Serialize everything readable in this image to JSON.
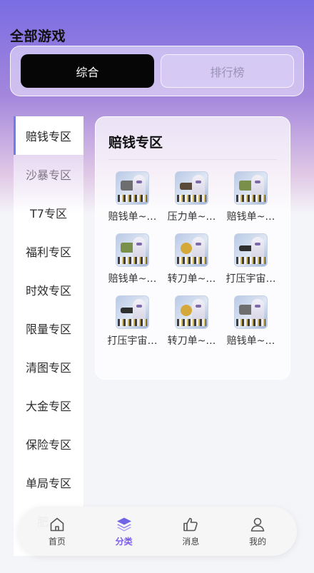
{
  "header": {
    "title": "全部游戏"
  },
  "tabs": [
    {
      "label": "综合",
      "active": true
    },
    {
      "label": "排行榜",
      "active": false
    }
  ],
  "sidebar": {
    "items": [
      {
        "label": "赔钱专区"
      },
      {
        "label": "沙暴专区"
      },
      {
        "label": "T7专区"
      },
      {
        "label": "福利专区"
      },
      {
        "label": "时效专区"
      },
      {
        "label": "限量专区"
      },
      {
        "label": "清图专区"
      },
      {
        "label": "大金专区"
      },
      {
        "label": "保险专区"
      },
      {
        "label": "单局专区"
      },
      {
        "label": "肥…"
      }
    ],
    "active_index": 0
  },
  "section": {
    "title": "赔钱专区",
    "games": [
      {
        "name": "赔钱单~…",
        "icon": "game-thumb-item"
      },
      {
        "name": "压力单~…",
        "icon": "game-thumb-box"
      },
      {
        "name": "赔钱单~…",
        "icon": "game-thumb-brick"
      },
      {
        "name": "赔钱单~…",
        "icon": "game-thumb-brick"
      },
      {
        "name": "转刀单~…",
        "icon": "game-thumb-gold"
      },
      {
        "name": "打压宇宙…",
        "icon": "game-thumb-gun"
      },
      {
        "name": "打压宇宙…",
        "icon": "game-thumb-gun"
      },
      {
        "name": "转刀单~…",
        "icon": "game-thumb-gold"
      },
      {
        "name": "赔钱单~…",
        "icon": "game-thumb-item"
      }
    ]
  },
  "nav": [
    {
      "label": "首页",
      "icon": "home-icon",
      "active": false
    },
    {
      "label": "分类",
      "icon": "layers-icon",
      "active": true
    },
    {
      "label": "消息",
      "icon": "thumbs-up-icon",
      "active": false
    },
    {
      "label": "我的",
      "icon": "user-icon",
      "active": false
    }
  ],
  "colors": {
    "accent": "#7a5ce8",
    "sidebar_indicator": "#6b7cf2",
    "tab_active_bg": "#060606"
  }
}
